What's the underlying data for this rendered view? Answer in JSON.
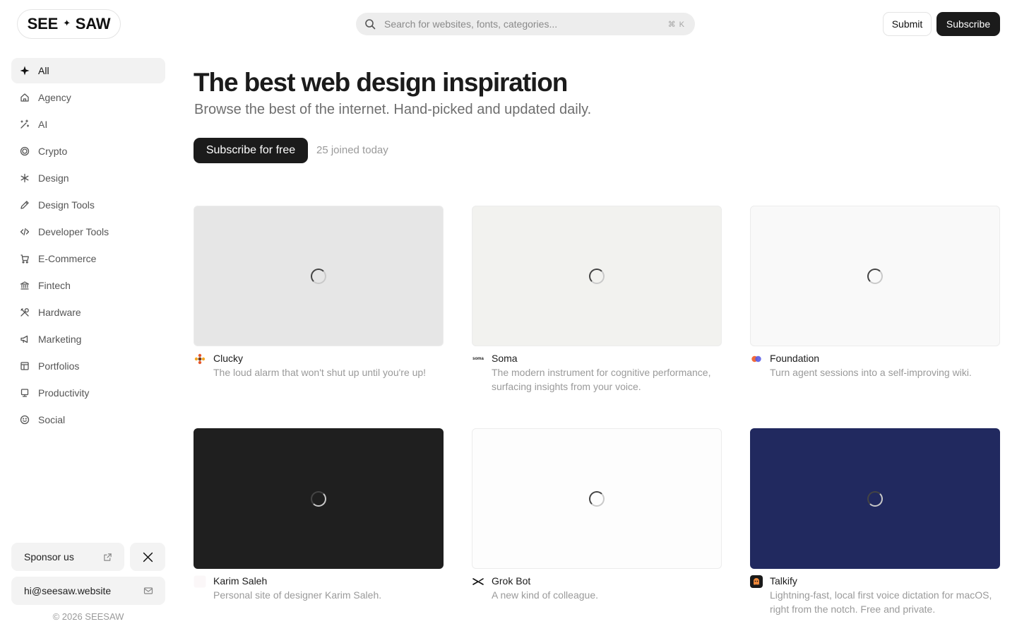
{
  "header": {
    "logo_left": "SEE",
    "logo_star": "✦",
    "logo_right": "SAW",
    "search_placeholder": "Search for websites, fonts, categories...",
    "search_shortcut": "⌘ K",
    "submit_label": "Submit",
    "subscribe_label": "Subscribe"
  },
  "sidebar": {
    "items": [
      {
        "label": "All",
        "icon": "sparkle-icon",
        "active": true
      },
      {
        "label": "Agency",
        "icon": "house-icon"
      },
      {
        "label": "AI",
        "icon": "magic-wand-icon"
      },
      {
        "label": "Crypto",
        "icon": "coin-icon"
      },
      {
        "label": "Design",
        "icon": "asterisk-icon"
      },
      {
        "label": "Design Tools",
        "icon": "pencil-icon"
      },
      {
        "label": "Developer Tools",
        "icon": "code-icon"
      },
      {
        "label": "E-Commerce",
        "icon": "cart-icon"
      },
      {
        "label": "Fintech",
        "icon": "bank-icon"
      },
      {
        "label": "Hardware",
        "icon": "tools-icon"
      },
      {
        "label": "Marketing",
        "icon": "megaphone-icon"
      },
      {
        "label": "Portfolios",
        "icon": "layout-icon"
      },
      {
        "label": "Productivity",
        "icon": "monitor-icon"
      },
      {
        "label": "Social",
        "icon": "smiley-icon"
      }
    ],
    "sponsor_label": "Sponsor us",
    "email_label": "hi@seesaw.website",
    "copyright": "© 2026 SEESAW"
  },
  "hero": {
    "title": "The best web design inspiration",
    "subtitle": "Browse the best of the internet. Hand-picked and updated daily.",
    "cta_label": "Subscribe for free",
    "joined_text": "25 joined today"
  },
  "cards": [
    {
      "title": "Clucky",
      "desc": "The loud alarm that won't shut up until you're up!",
      "thumb_color": "#e6e6e6",
      "favicon": "clucky-logo-icon"
    },
    {
      "title": "Soma",
      "desc": "The modern instrument for cognitive performance, surfacing insights from your voice.",
      "thumb_color": "#f2f2ef",
      "favicon": "soma-logo-icon",
      "favicon_text": "soma"
    },
    {
      "title": "Foundation",
      "desc": "Turn agent sessions into a self-improving wiki.",
      "thumb_color": "#f9f9f9",
      "favicon": "foundation-logo-icon"
    },
    {
      "title": "Karim Saleh",
      "desc": "Personal site of designer Karim Saleh.",
      "thumb_color": "#1f1f1f",
      "favicon": "karim-logo-icon"
    },
    {
      "title": "Grok Bot",
      "desc": "A new kind of colleague.",
      "thumb_color": "#fdfdfd",
      "favicon": "grok-logo-icon"
    },
    {
      "title": "Talkify",
      "desc": "Lightning-fast, local first voice dictation for macOS, right from the notch. Free and private.",
      "thumb_color": "#21295f",
      "favicon": "talkify-logo-icon"
    }
  ]
}
